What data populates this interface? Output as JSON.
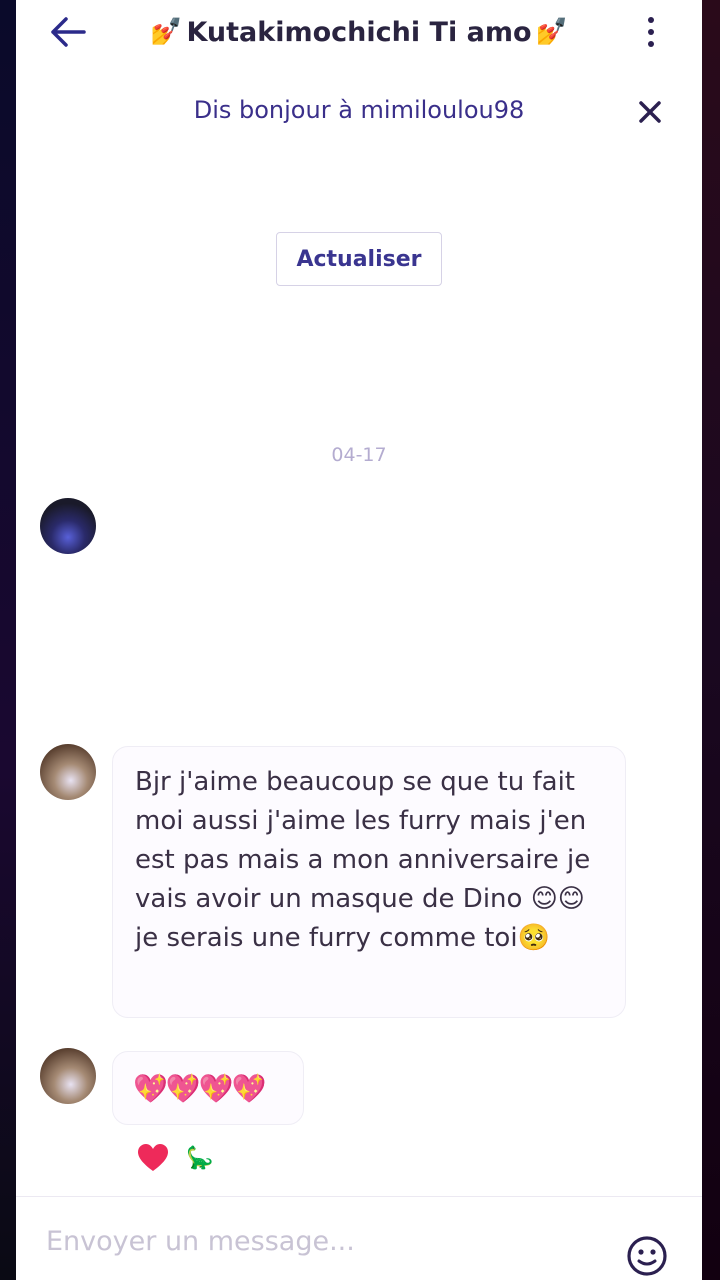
{
  "header": {
    "title": "Kutakimochichi Ti amo",
    "title_emoji_left": "💅",
    "title_emoji_right": "💅",
    "back_icon": "arrow-left-icon",
    "menu_icon": "more-vertical-icon"
  },
  "hello_banner": {
    "text": "Dis bonjour à mimiloulou98",
    "close_icon": "close-icon"
  },
  "refresh_button": {
    "label": "Actualiser"
  },
  "date_separator": "04-17",
  "messages": [
    {
      "type": "media",
      "text": ""
    },
    {
      "type": "text",
      "text": "Bjr j'aime beaucoup se que tu fait moi aussi j'aime les furry mais j'en est pas mais a mon anniversaire je vais avoir un masque de Dino 😊😊 je serais une furry comme toi🥺"
    },
    {
      "type": "emoji",
      "text": "💖💖💖💖"
    }
  ],
  "reactions": {
    "heart_icon": "heart-icon",
    "secondary": "🦕"
  },
  "composer": {
    "placeholder": "Envoyer un message...",
    "emoji_icon": "smiley-icon"
  },
  "colors": {
    "accent": "#3a2f8a",
    "heart": "#ee2a5a",
    "placeholder": "#c8c3d4"
  }
}
